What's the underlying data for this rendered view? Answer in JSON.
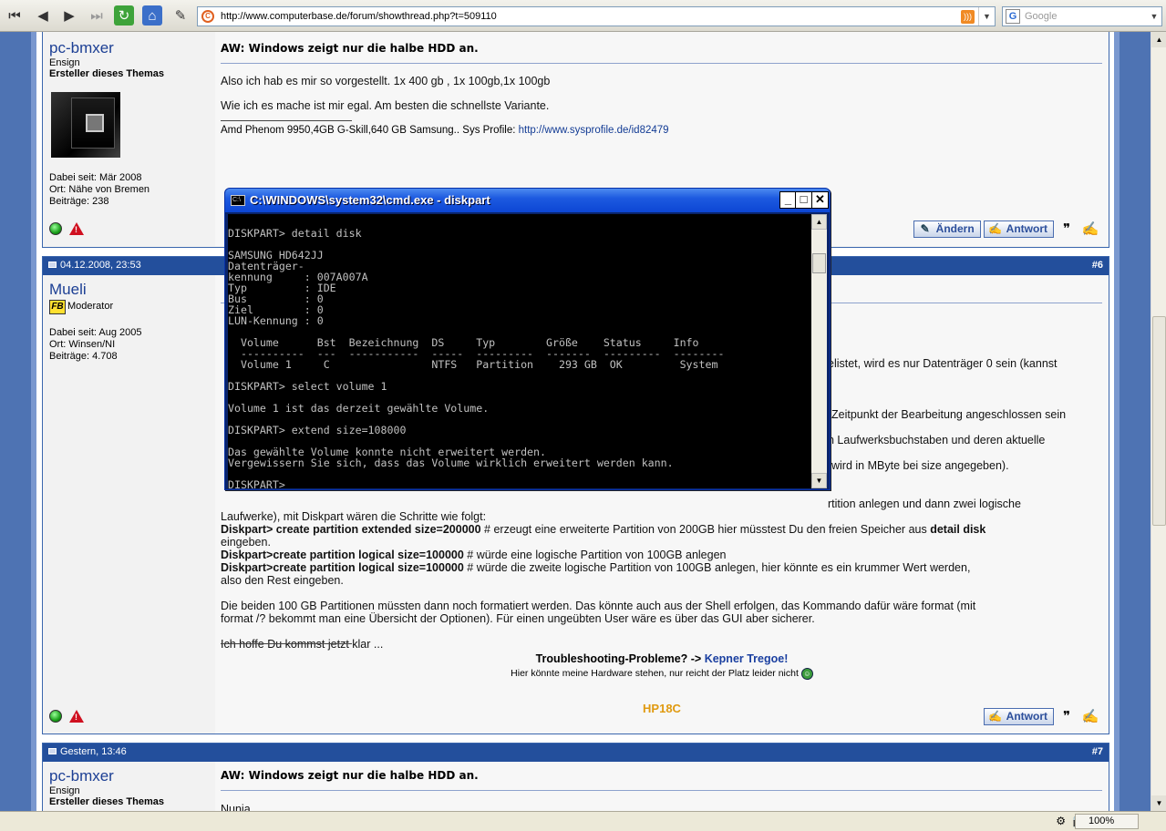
{
  "browser": {
    "url": "http://www.computerbase.de/forum/showthread.php?t=509110",
    "search_placeholder": "Google",
    "zoom": "100%"
  },
  "post1": {
    "user": "pc-bmxer",
    "rank": "Ensign",
    "starter": "Ersteller dieses Themas",
    "joined": "Dabei seit: Mär 2008",
    "location": "Ort: Nähe von Bremen",
    "posts": "Beiträge: 238",
    "title": "AW: Windows zeigt nur die halbe HDD an.",
    "line1": "Also ich hab es mir so vorgestellt. 1x 400 gb , 1x 100gb,1x 100gb",
    "line2": "Wie ich es mache ist mir egal. Am besten die schnellste Variante.",
    "sig_text": "Amd Phenom 9950,4GB G-Skill,640 GB Samsung.. Sys Profile: ",
    "sig_link": "http://www.sysprofile.de/id82479",
    "btn_edit": "Ändern",
    "btn_reply": "Antwort"
  },
  "post2": {
    "date": "04.12.2008, 23:53",
    "num": "#6",
    "user": "Mueli",
    "rank": "Moderator",
    "badge": "FB",
    "joined": "Dabei seit: Aug 2005",
    "location": "Ort: Winsen/NI",
    "posts": "Beiträge: 4.708",
    "frag1": "elistet, wird es nur Datenträger 0 sein (kannst",
    "frag2": "Zeitpunkt der Bearbeitung angeschlossen sein",
    "frag3": "n Laufwerksbuchstaben und deren aktuelle",
    "frag4": "wird in MByte bei size angegeben).",
    "frag5": "rtition anlegen und dann zwei logische",
    "p1a": "Laufwerke), mit Diskpart wären die Schritte wie folgt:",
    "p1b_b": "Diskpart> create partition extended size=200000",
    "p1b_n": " # erzeugt eine erweiterte Partition von 200GB hier müsstest Du den freien Speicher aus ",
    "p1b_b2": "detail disk",
    "p1c": "eingeben.",
    "p1d_b": "Diskpart>create partition logical size=100000",
    "p1d_n": " # würde eine logische Partition von 100GB anlegen",
    "p1e_b": "Diskpart>create partition logical size=100000",
    "p1e_n": " # würde die zweite logische Partition von 100GB anlegen, hier könnte es ein krummer Wert werden,",
    "p1f": "also den Rest eingeben.",
    "p2": "Die beiden 100 GB Partitionen müssten dann noch formatiert werden. Das könnte auch aus der Shell erfolgen, das Kommando dafür wäre format (mit",
    "p2b": "format /? bekommt man eine Übersicht der Optionen). Für einen ungeübten User wäre es über das GUI aber sicherer.",
    "p3": "Ich hoffe Du kommst jetzt klar ...",
    "sig1_pre": "Troubleshooting-Probleme? -> ",
    "sig1_link": "Kepner Tregoe!",
    "sig2": "Hier könnte meine Hardware stehen, nur reicht der Platz leider nicht",
    "sig3": "HP18C",
    "btn_reply": "Antwort"
  },
  "post3": {
    "date": "Gestern, 13:46",
    "num": "#7",
    "user": "pc-bmxer",
    "rank": "Ensign",
    "starter": "Ersteller dieses Themas",
    "title": "AW: Windows zeigt nur die halbe HDD an.",
    "line1": "Nunja.."
  },
  "cmd": {
    "title": "C:\\WINDOWS\\system32\\cmd.exe - diskpart",
    "output": "\nDISKPART> detail disk\n\nSAMSUNG HD642JJ\nDatenträger-\nkennung     : 007A007A\nTyp         : IDE\nBus         : 0\nZiel        : 0\nLUN-Kennung : 0\n\n  Volume      Bst  Bezeichnung  DS     Typ        Größe    Status     Info\n  ----------  ---  -----------  -----  ---------  -------  ---------  --------\n  Volume 1     C                NTFS   Partition    293 GB  OK         System\n\nDISKPART> select volume 1\n\nVolume 1 ist das derzeit gewählte Volume.\n\nDISKPART> extend size=108000\n\nDas gewählte Volume konnte nicht erweitert werden.\nVergewissern Sie sich, dass das Volume wirklich erweitert werden kann.\n\nDISKPART> "
  }
}
